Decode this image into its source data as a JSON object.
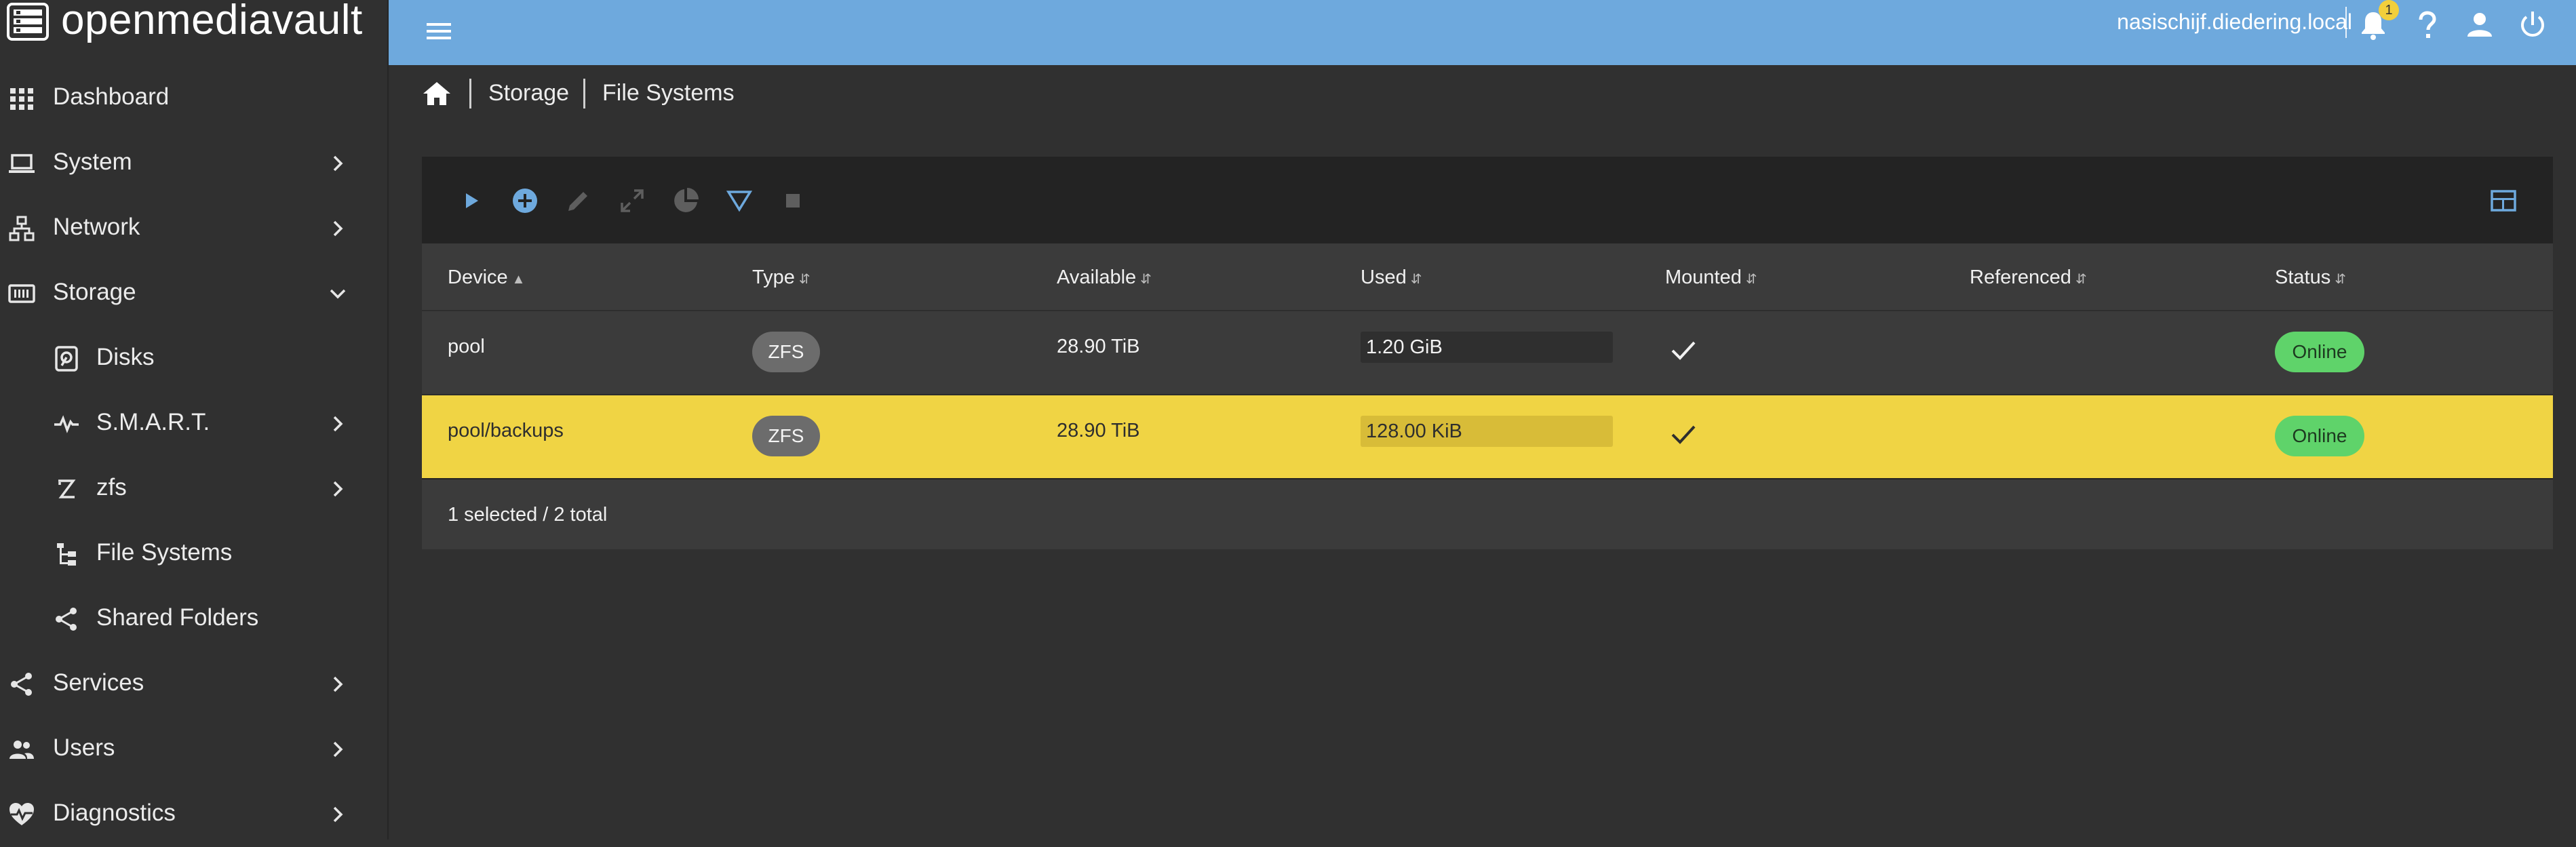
{
  "app": {
    "title": "openmediavault"
  },
  "topbar": {
    "hostname": "nasischijf.diedering.local",
    "notification_count": "1",
    "colors": {
      "bar": "#6ea9dd",
      "badge": "#f2cf3b"
    }
  },
  "sidebar": {
    "items": [
      {
        "label": "Dashboard",
        "icon": "grid-icon"
      },
      {
        "label": "System",
        "icon": "laptop-icon",
        "chevron": "right"
      },
      {
        "label": "Network",
        "icon": "network-icon",
        "chevron": "right"
      },
      {
        "label": "Storage",
        "icon": "storage-icon",
        "chevron": "down"
      },
      {
        "label": "Disks",
        "icon": "disk-icon"
      },
      {
        "label": "S.M.A.R.T.",
        "icon": "pulse-icon",
        "chevron": "right"
      },
      {
        "label": "zfs",
        "icon": "zfs-icon",
        "chevron": "right"
      },
      {
        "label": "File Systems",
        "icon": "file-tree-icon"
      },
      {
        "label": "Shared Folders",
        "icon": "share-icon"
      },
      {
        "label": "Services",
        "icon": "share-icon",
        "chevron": "right"
      },
      {
        "label": "Users",
        "icon": "users-icon",
        "chevron": "right"
      },
      {
        "label": "Diagnostics",
        "icon": "heart-pulse-icon",
        "chevron": "right"
      }
    ]
  },
  "breadcrumb": {
    "items": [
      "Storage",
      "File Systems"
    ]
  },
  "table": {
    "columns": [
      "Device",
      "Type",
      "Available",
      "Used",
      "Mounted",
      "Referenced",
      "Status"
    ],
    "rows": [
      {
        "device": "pool",
        "type": "ZFS",
        "available": "28.90 TiB",
        "used": "1.20 GiB",
        "used_fraction": 0.0,
        "mounted": true,
        "referenced": "",
        "status": "Online",
        "selected": false
      },
      {
        "device": "pool/backups",
        "type": "ZFS",
        "available": "28.90 TiB",
        "used": "128.00 KiB",
        "used_fraction": 0.0,
        "mounted": true,
        "referenced": "",
        "status": "Online",
        "selected": true
      }
    ],
    "footer": "1 selected / 2 total",
    "colors": {
      "selected_row": "#f0d444",
      "status_online": "#5fd36a"
    }
  }
}
